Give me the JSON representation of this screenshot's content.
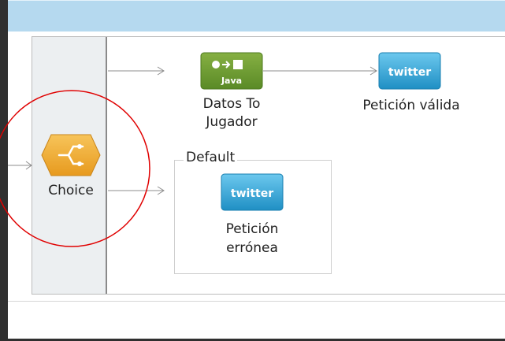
{
  "flow": {
    "choice": {
      "label": "Choice",
      "icon": "choice-router-icon",
      "color": "#f0a830"
    },
    "java_node": {
      "icon_text": "Java",
      "label_line1": "Datos To",
      "label_line2": "Jugador",
      "color": "#6b9a32"
    },
    "twitter_valid": {
      "icon_text": "twitter",
      "label": "Petición válida"
    },
    "default_route": {
      "label": "Default"
    },
    "twitter_error": {
      "icon_text": "twitter",
      "label_line1": "Petición",
      "label_line2": "errónea"
    }
  },
  "colors": {
    "title_bar": "#b5d9ef",
    "highlight_circle": "#e00000",
    "twitter_blue": "#2aa9e0"
  }
}
